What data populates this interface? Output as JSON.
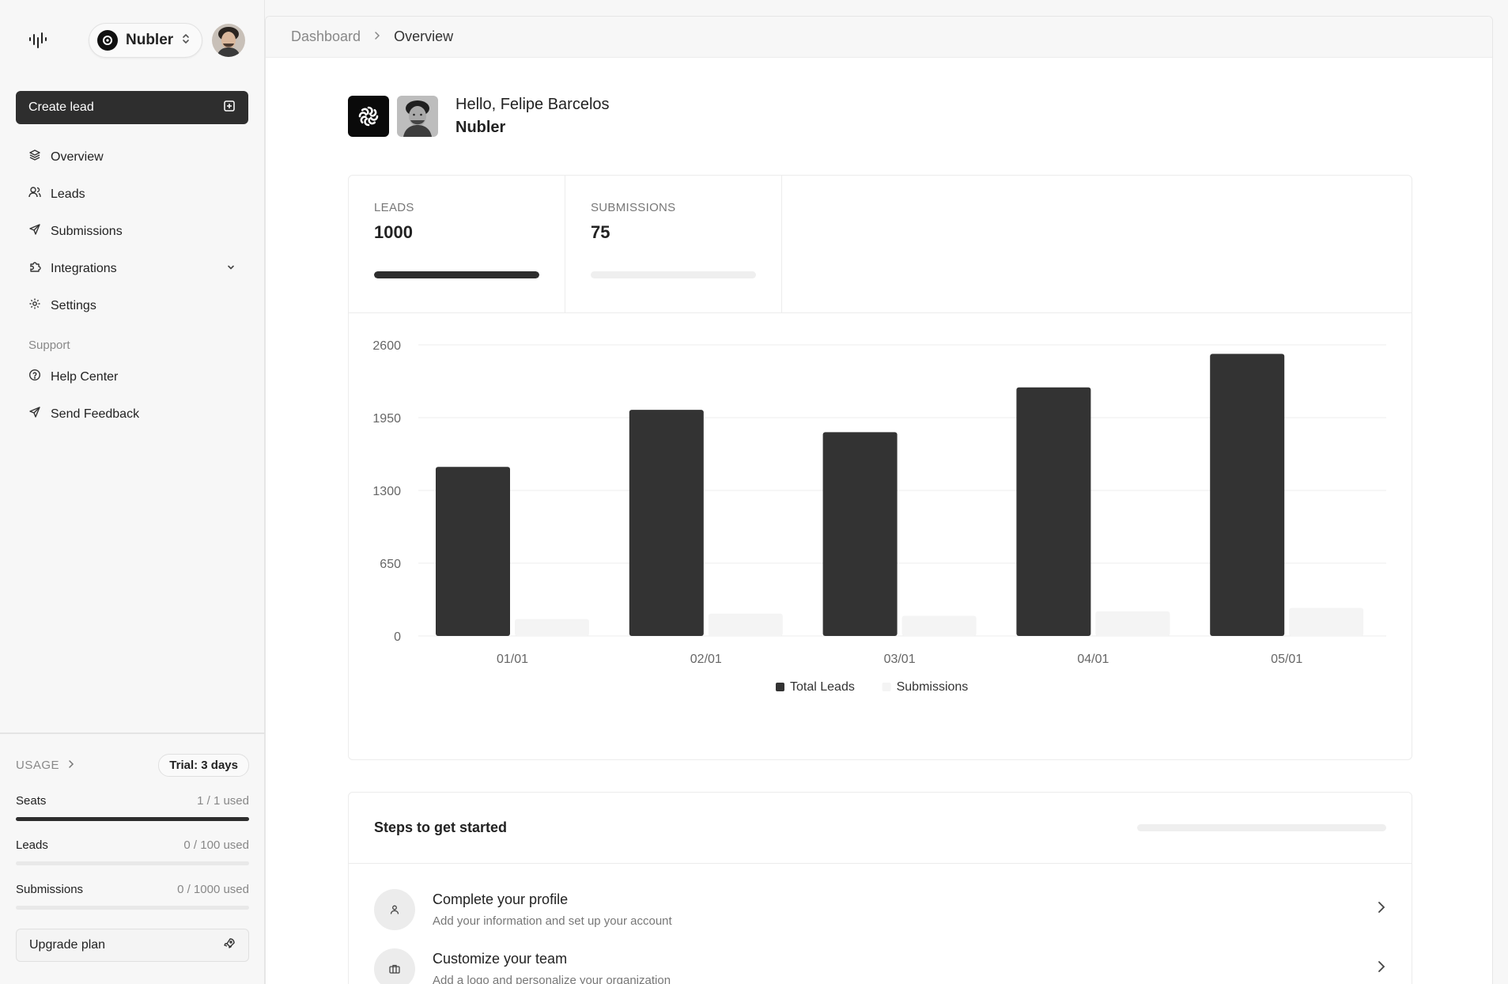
{
  "sidebar": {
    "org_name": "Nubler",
    "create_lead_label": "Create lead",
    "nav": [
      {
        "label": "Overview",
        "icon": "layers-icon"
      },
      {
        "label": "Leads",
        "icon": "users-icon"
      },
      {
        "label": "Submissions",
        "icon": "send-icon"
      },
      {
        "label": "Integrations",
        "icon": "puzzle-icon"
      },
      {
        "label": "Settings",
        "icon": "gear-icon"
      }
    ],
    "support_label": "Support",
    "support": [
      {
        "label": "Help Center",
        "icon": "help-circle-icon"
      },
      {
        "label": "Send Feedback",
        "icon": "send-icon"
      }
    ],
    "usage": {
      "title": "USAGE",
      "trial": "Trial: 3 days",
      "rows": [
        {
          "label": "Seats",
          "value": "1 / 1 used",
          "fraction": 1.0
        },
        {
          "label": "Leads",
          "value": "0 / 100 used",
          "fraction": 0
        },
        {
          "label": "Submissions",
          "value": "0 / 1000 used",
          "fraction": 0
        }
      ],
      "upgrade_label": "Upgrade plan"
    }
  },
  "breadcrumb": {
    "parent": "Dashboard",
    "current": "Overview"
  },
  "greeting": {
    "hello": "Hello, Felipe Barcelos",
    "org": "Nubler"
  },
  "stats": [
    {
      "label": "LEADS",
      "value": "1000",
      "fraction": 1.0
    },
    {
      "label": "SUBMISSIONS",
      "value": "75",
      "fraction": 0
    }
  ],
  "chart_data": {
    "type": "bar",
    "categories": [
      "01/01",
      "02/01",
      "03/01",
      "04/01",
      "05/01"
    ],
    "series": [
      {
        "name": "Total Leads",
        "values": [
          1510,
          2020,
          1820,
          2220,
          2520
        ],
        "color": "#333333"
      },
      {
        "name": "Submissions",
        "values": [
          150,
          200,
          180,
          220,
          250
        ],
        "color": "#f4f4f4"
      }
    ],
    "ylim": [
      0,
      2600
    ],
    "yticks": [
      0,
      650,
      1300,
      1950,
      2600
    ],
    "grid": true,
    "legend": "bottom"
  },
  "steps": {
    "title": "Steps to get started",
    "items": [
      {
        "title": "Complete your profile",
        "sub": "Add your information and set up your account",
        "icon": "user-icon"
      },
      {
        "title": "Customize your team",
        "sub": "Add a logo and personalize your organization",
        "icon": "briefcase-icon"
      }
    ]
  }
}
